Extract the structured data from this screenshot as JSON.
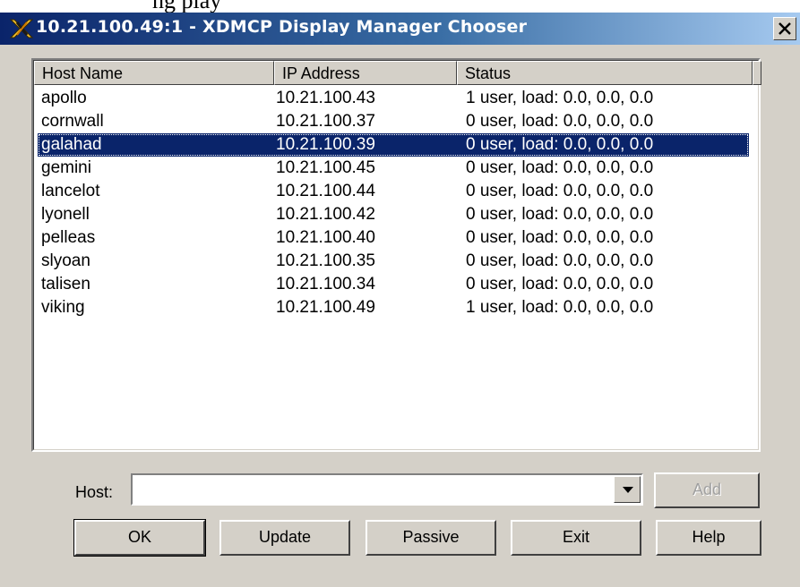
{
  "page_fragment": "ng                               play",
  "window": {
    "title": "10.21.100.49:1 - XDMCP Display Manager Chooser",
    "icon": "xming-x-icon",
    "close_label": "×"
  },
  "list": {
    "columns": [
      "Host Name",
      "IP Address",
      "Status",
      ""
    ],
    "rows": [
      {
        "host": "apollo",
        "ip": "10.21.100.43",
        "status": "1 user,  load: 0.0, 0.0, 0.0",
        "selected": false
      },
      {
        "host": "cornwall",
        "ip": "10.21.100.37",
        "status": "0 user,  load: 0.0, 0.0, 0.0",
        "selected": false
      },
      {
        "host": "galahad",
        "ip": "10.21.100.39",
        "status": "0 user,  load: 0.0, 0.0, 0.0",
        "selected": true
      },
      {
        "host": "gemini",
        "ip": "10.21.100.45",
        "status": "0 user,  load: 0.0, 0.0, 0.0",
        "selected": false
      },
      {
        "host": "lancelot",
        "ip": "10.21.100.44",
        "status": "0 user,  load: 0.0, 0.0, 0.0",
        "selected": false
      },
      {
        "host": "lyonell",
        "ip": "10.21.100.42",
        "status": "0 user,  load: 0.0, 0.0, 0.0",
        "selected": false
      },
      {
        "host": "pelleas",
        "ip": "10.21.100.40",
        "status": "0 user,  load: 0.0, 0.0, 0.0",
        "selected": false
      },
      {
        "host": "slyoan",
        "ip": "10.21.100.35",
        "status": "0 user,  load: 0.0, 0.0, 0.0",
        "selected": false
      },
      {
        "host": "talisen",
        "ip": "10.21.100.34",
        "status": "0 user,  load: 0.0, 0.0, 0.0",
        "selected": false
      },
      {
        "host": "viking",
        "ip": "10.21.100.49",
        "status": "1 user,  load: 0.0, 0.0, 0.0",
        "selected": false
      }
    ]
  },
  "host_field": {
    "label": "Host:",
    "value": "",
    "placeholder": ""
  },
  "buttons": {
    "add": "Add",
    "ok": "OK",
    "update": "Update",
    "passive": "Passive",
    "exit": "Exit",
    "help": "Help"
  },
  "colors": {
    "selection": "#0a246a",
    "face": "#d4d0c8",
    "title_start": "#0a246a",
    "title_end": "#a6caf0"
  }
}
